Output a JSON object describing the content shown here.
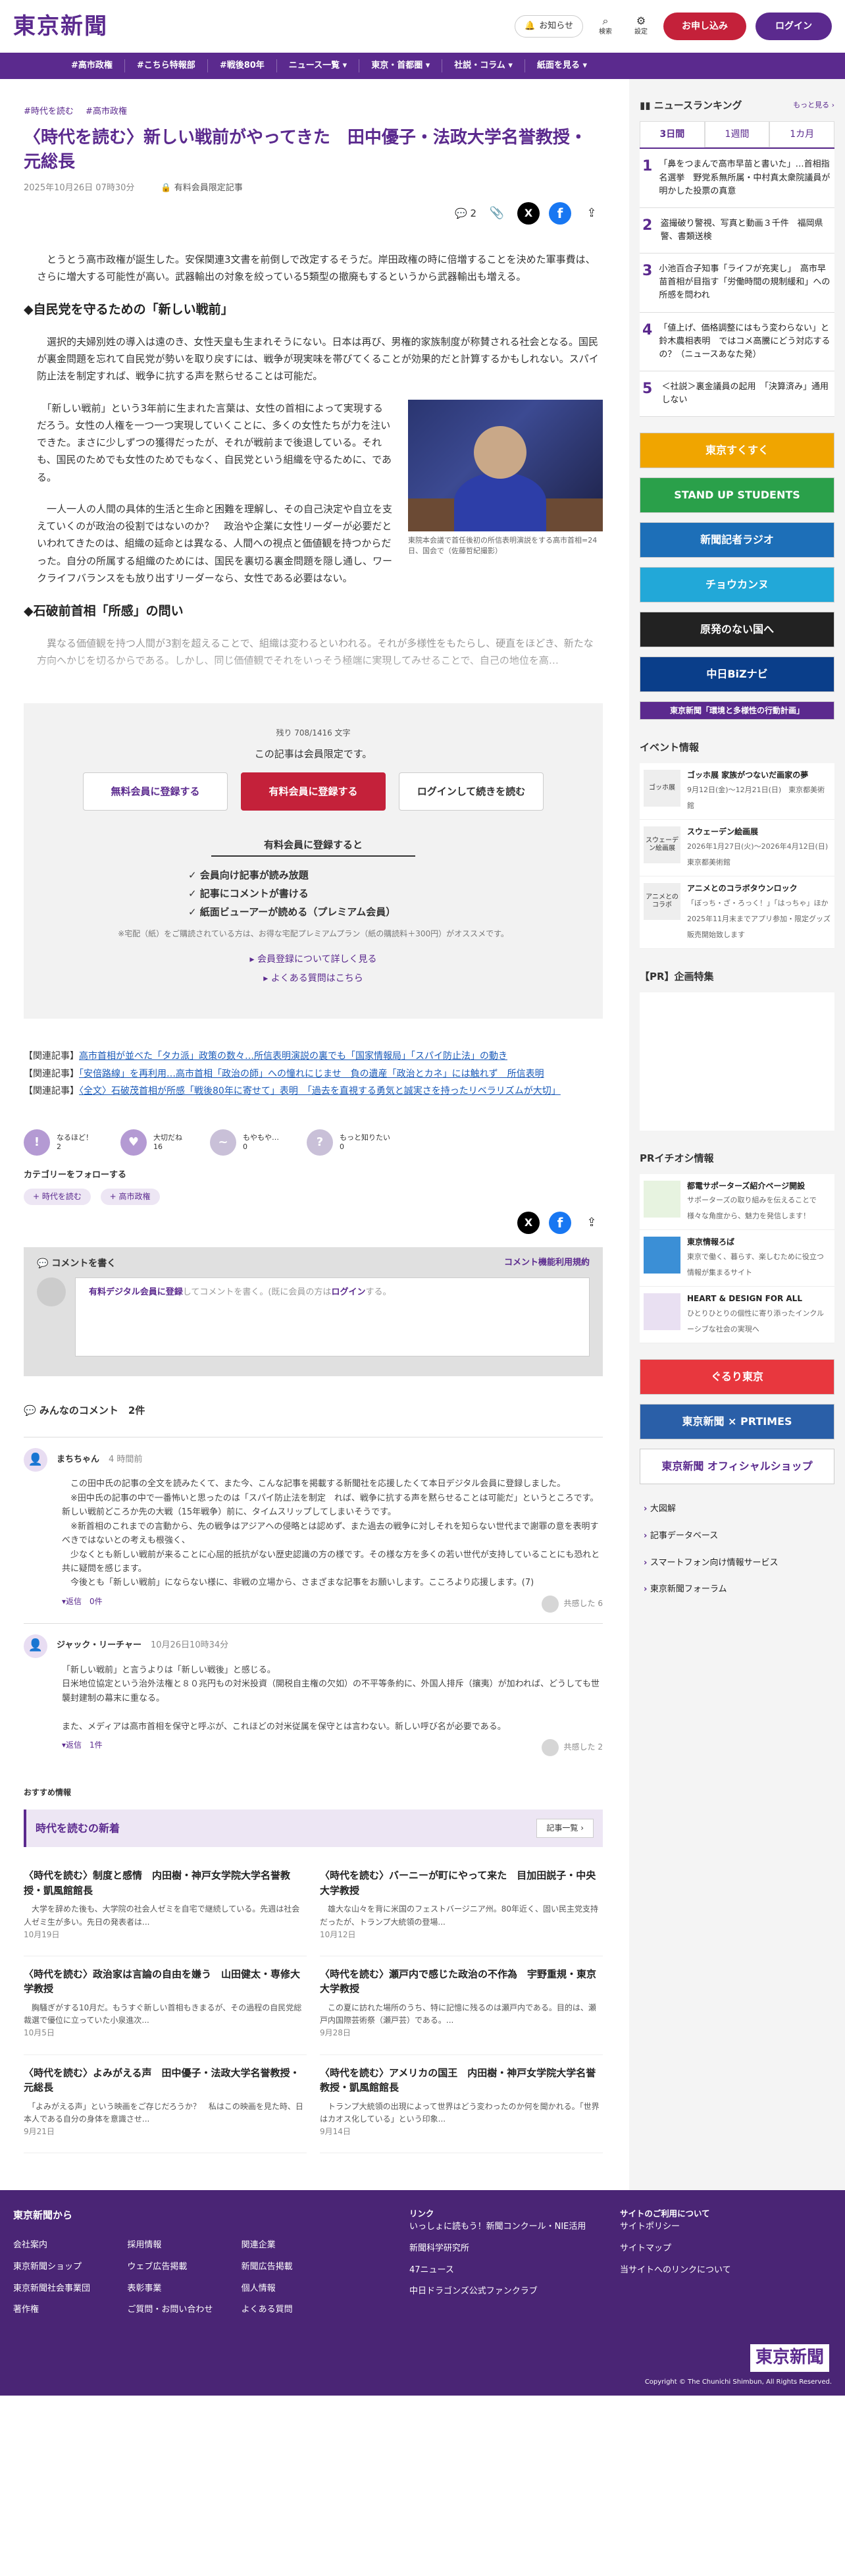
{
  "header": {
    "logo": "東京新聞",
    "notice": "お知らせ",
    "search": "検索",
    "settings": "設定",
    "signup": "お申し込み",
    "login": "ログイン"
  },
  "nav": [
    "#高市政権",
    "#こちら特報部",
    "#戦後80年",
    "ニュース一覧 ▾",
    "東京・首都圏 ▾",
    "社説・コラム ▾",
    "紙面を見る ▾"
  ],
  "article": {
    "tags": [
      "#時代を読む",
      "#高市政権"
    ],
    "title": "〈時代を読む〉新しい戦前がやってきた　田中優子・法政大学名誉教授・元総長",
    "date": "2025年10月26日 07時30分",
    "members": "有料会員限定記事",
    "comment_count": "2",
    "p1": "　とうとう高市政権が誕生した。安保関連3文書を前倒しで改定するそうだ。岸田政権の時に倍増することを決めた軍事費は、さらに増大する可能性が高い。武器輸出の対象を絞っている5類型の撤廃もするというから武器輸出も増える。",
    "h1": "◆自民党を守るための「新しい戦前」",
    "p2": "　選択的夫婦別姓の導入は遠のき、女性天皇も生まれそうにない。日本は再び、男権的家族制度が称賛される社会となる。国民が裏金問題を忘れて自民党が勢いを取り戻すには、戦争が現実味を帯びてくることが効果的だと計算するかもしれない。スパイ防止法を制定すれば、戦争に抗する声を黙らせることは可能だ。",
    "p3": "　「新しい戦前」という3年前に生まれた言葉は、女性の首相によって実現するだろう。女性の人権を一つ一つ実現していくことに、多くの女性たちが力を注いできた。まさに少しずつの獲得だったが、それが戦前まで後退している。それも、国民のためでも女性のためでもなく、自民党という組織を守るために、である。",
    "p4": "　一人一人の人間の具体的生活と生命と困難を理解し、その自己決定や自立を支えていくのが政治の役割ではないのか？　政治や企業に女性リーダーが必要だといわれてきたのは、組織の延命とは異なる、人間への視点と価値観を持つからだった。自分の所属する組織のためには、国民を裏切る裏金問題を隠し通し、ワークライフバランスをも放り出すリーダーなら、女性である必要はない。",
    "caption": "東院本会議で首任後初の所信表明演説をする高市首相=24日、国会で（佐藤哲紀撮影）",
    "h2": "◆石破前首相「所感」の問い",
    "p5": "　異なる価値観を持つ人間が3割を超えることで、組織は変わるといわれる。それが多様性をもたらし、硬直をほどき、新たな方向へかじを切るからである。しかし、同じ価値観でそれをいっそう極端に実現してみせることで、自己の地位を高…"
  },
  "paywall": {
    "remaining": "残り 708/1416 文字",
    "msg": "この記事は会員限定です。",
    "free": "無料会員に登録する",
    "paid": "有料会員に登録する",
    "login": "ログインして続きを読む",
    "benefit_h": "有料会員に登録すると",
    "benefits": [
      "会員向け記事が読み放題",
      "記事にコメントが書ける",
      "紙面ビューアーが読める（プレミアム会員）"
    ],
    "note": "※宅配（紙）をご購読されている方は、お得な宅配プレミアムプラン（紙の購読料＋300円）がオススメです。",
    "more": "▸ 会員登録について詳しく見る",
    "faq": "▸ よくある質問はこちら"
  },
  "related": [
    {
      "label": "【関連記事】",
      "text": "高市首相が並べた「タカ派」政策の数々…所信表明演説の裏でも「国家情報局」「スパイ防止法」の動き"
    },
    {
      "label": "【関連記事】",
      "text": "「安倍路線」を再利用…高市首相「政治の師」への憧れにじませ　負の遺産「政治とカネ」には触れず　所信表明"
    },
    {
      "label": "【関連記事】",
      "text": "〈全文〉石破茂首相が所感「戦後80年に寄せて」表明　「過去を直視する勇気と誠実さを持ったリベラリズムが大切」"
    }
  ],
  "reactions": [
    {
      "label": "なるほど！",
      "count": "2",
      "g": "!"
    },
    {
      "label": "大切だね",
      "count": "16",
      "g": "♥"
    },
    {
      "label": "もやもや…",
      "count": "0",
      "g": "~"
    },
    {
      "label": "もっと知りたい",
      "count": "0",
      "g": "?"
    }
  ],
  "follow": {
    "title": "カテゴリーをフォローする",
    "chips": [
      "+ 時代を読む",
      "+ 高市政権"
    ]
  },
  "comment_write": {
    "title": "コメントを書く",
    "rules": "コメント機能利用規約",
    "placeholder_pre": "有料デジタル会員に登録",
    "placeholder_mid": "してコメントを書く。(既に会員の方は",
    "placeholder_login": "ログイン",
    "placeholder_post": "する。"
  },
  "comments": {
    "title": "みんなのコメント　2件",
    "items": [
      {
        "name": "まちちゃん",
        "time": "4 時間前",
        "body": "　この田中氏の記事の全文を読みたくて、また今、こんな記事を掲載する新聞社を応援したくて本日デジタル会員に登録しました。\n　※田中氏の記事の中で一番怖いと思ったのは「スパイ防止法を制定　れば、戦争に抗する声を黙らせることは可能だ」というところです。新しい戦前どころか先の大戦（15年戦争）前に、タイムスリップしてしまいそうです。\n　※新首相のこれまでの言動から、先の戦争はアジアへの侵略とは認めず、また過去の戦争に対しそれを知らない世代まで謝罪の意を表明すべきではないとの考えも根強く、\n　少なくとも新しい戦前が来ることに心屈的抵抗がない歴史認識の方の様です。その様な方を多くの若い世代が支持していることにも恐れと共に疑問を感じます。\n　今後とも「新しい戦前」にならない様に、非戦の立場から、さまざまな記事をお願いします。こころより応援します。(7)",
        "reply": "▾返信　0件",
        "stamp": "共感した 6"
      },
      {
        "name": "ジャック・リーチャー",
        "time": "10月26日10時34分",
        "body": "「新しい戦前」と言うよりは「新しい戦後」と感じる。\n日米地位協定という治外法権と８０兆円もの対米投資（開税自主権の欠如）の不平等条約に、外国人排斥（攘夷）が加われば、どうしても世襲封建制の幕末に重なる。\n\nまた、メディアは高市首相を保守と呼ぶが、これほどの対米従属を保守とは言わない。新しい呼び名が必要である。",
        "reply": "▾返信　1件",
        "stamp": "共感した 2"
      }
    ]
  },
  "recommend": {
    "head": "おすすめ情報",
    "section": "時代を読むの新着",
    "all": "記事一覧 ›",
    "cards": [
      {
        "t": "〈時代を読む〉制度と感情　内田樹・神戸女学院大学名誉教授・凱風館館長",
        "d": "　大学を辞めた後も、大学院の社会人ゼミを自宅で継続している。先週は社会人ゼミ生が多い。先日の発表者は...",
        "dt": "10月19日"
      },
      {
        "t": "〈時代を読む〉バーニーが町にやって来た　目加田説子・中央大学教授",
        "d": "　雄大な山々を背に米国のフェストバージニア州。80年近く、固い民主党支持だったが、トランプ大統領の登場...",
        "dt": "10月12日"
      },
      {
        "t": "〈時代を読む〉政治家は言論の自由を嫌う　山田健太・専修大学教授",
        "d": "　胸騒ぎがする10月だ。もうすぐ新しい首相もきまるが、その過程の自民党総裁選で優位に立っていた小泉進次...",
        "dt": "10月5日"
      },
      {
        "t": "〈時代を読む〉瀬戸内で感じた政治の不作為　宇野重規・東京大学教授",
        "d": "　この夏に訪れた場所のうち、特に記憶に残るのは瀬戸内である。目的は、瀬戸内国際芸術祭（瀬戸芸）である。...",
        "dt": "9月28日"
      },
      {
        "t": "〈時代を読む〉よみがえる声　田中優子・法政大学名誉教授・元総長",
        "d": "　「よみがえる声」という映画をご存じだろうか？　私はこの映画を見た時、日本人である自分の身体を意識させ...",
        "dt": "9月21日"
      },
      {
        "t": "〈時代を読む〉アメリカの国王　内田樹・神戸女学院大学名誉教授・凱風館館長",
        "d": "　トランプ大統領の出現によって世界はどう変わったのか何を聞かれる。「世界はカオス化している」という印象...",
        "dt": "9月14日"
      }
    ]
  },
  "sidebar": {
    "ranking_title": "ニュースランキング",
    "more": "もっと見る ›",
    "tabs": [
      "3日間",
      "1週間",
      "1カ月"
    ],
    "rank": [
      {
        "n": "1",
        "t": "「鼻をつまんで高市早苗と書いた」…首相指名選挙　野党系無所属・中村真太衆院議員が明かした投票の真意"
      },
      {
        "n": "2",
        "t": "盗撮破り警視、写真と動画３千件　福岡県警、書類送検"
      },
      {
        "n": "3",
        "t": "小池百合子知事「ライフが充実し」　高市早苗首相が目指す「労働時間の規制緩和」への所感を問われ"
      },
      {
        "n": "4",
        "t": "「値上げ、価格調整にはもう変わらない」と鈴木農相表明　ではコメ高騰にどう対応するの？（ニュースあなた発）"
      },
      {
        "n": "5",
        "t": "＜社説＞裏金議員の起用　「決算済み」通用しない"
      }
    ],
    "banners": [
      "東京すくすく",
      "STAND UP STUDENTS",
      "新聞記者ラジオ",
      "チョウカンヌ",
      "原発のない国へ",
      "中日BiZナビ",
      "東京新聞「環境と多様性の行動計画」"
    ],
    "events_title": "イベント情報",
    "events": [
      {
        "img": "ゴッホ展",
        "t": "ゴッホ展 家族がつないだ画家の夢",
        "d": "9月12日(金)〜12月21日(日)　東京都美術館"
      },
      {
        "img": "スウェーデン絵画展",
        "t": "スウェーデン絵画展",
        "d": "2026年1月27日(火)〜2026年4月12日(日)　東京都美術館"
      },
      {
        "img": "アニメとのコラボ",
        "t": "アニメとのコラボタウンロック",
        "d": "「ぼっち・ざ・ろっく！」「はっちゃ」ほか 2025年11月末までアプリ参加・限定グッズ販売開始致します"
      }
    ],
    "pr_title": "【PR】企画特集",
    "prichi_title": "PRイチオシ情報",
    "prichi": [
      {
        "t": "都電サポーターズ紹介ページ開設",
        "d": "サポーターズの取り組みを伝えることで様々な角度から、魅力を発信します！"
      },
      {
        "t": "東京情報ろば",
        "d": "東京で働く、暮らす、楽しむために役立つ情報が集まるサイト"
      },
      {
        "t": "HEART & DESIGN FOR ALL",
        "d": "ひとりひとりの個性に寄り添ったインクルーシブな社会の実現へ"
      }
    ],
    "banners2": [
      "ぐるり東京",
      "東京新聞 × PRTIMES",
      "東京新聞 オフィシャルショップ"
    ],
    "links": [
      "大図解",
      "記事データベース",
      "スマートフォン向け情報サービス",
      "東京新聞フォーラム"
    ]
  },
  "footer": {
    "col1": "東京新聞から",
    "c1": [
      "会社案内",
      "採用情報",
      "関連企業",
      "東京新聞ショップ",
      "ウェブ広告掲載",
      "新聞広告掲載",
      "東京新聞社会事業団",
      "表彰事業",
      "個人情報",
      "著作権",
      "ご質問・お問い合わせ",
      "よくある質問"
    ],
    "col2": "リンク",
    "c2a": [
      "いっしょに読もう！新聞コンクール・NIE活用",
      "新聞科学研究所",
      "47ニュース",
      "中日ドラゴンズ公式ファンクラブ"
    ],
    "col3": "サイトのご利用について",
    "c3": [
      "サイトポリシー",
      "サイトマップ",
      "当サイトへのリンクについて"
    ],
    "logo": "東京新聞",
    "copyright": "Copyright © The Chunichi Shimbun, All Rights Reserved."
  }
}
